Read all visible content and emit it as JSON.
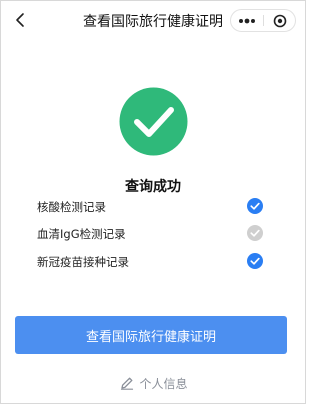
{
  "header": {
    "title": "查看国际旅行健康证明",
    "back_icon": "chevron-left-icon",
    "more_icon": "more-dots-icon",
    "close_icon": "target-close-icon"
  },
  "result": {
    "status_icon": "check-circle-icon",
    "status_color": "#2fb97a",
    "title": "查询成功"
  },
  "records": [
    {
      "label": "核酸检测记录",
      "checked": true
    },
    {
      "label": "血清IgG检测记录",
      "checked": false
    },
    {
      "label": "新冠疫苗接种记录",
      "checked": true
    }
  ],
  "actions": {
    "primary_label": "查看国际旅行健康证明",
    "primary_color": "#4c8ff0",
    "profile_icon": "pencil-icon",
    "profile_label": "个人信息"
  },
  "colors": {
    "check_active": "#2a7ef3",
    "check_inactive": "#cfcfcf"
  }
}
